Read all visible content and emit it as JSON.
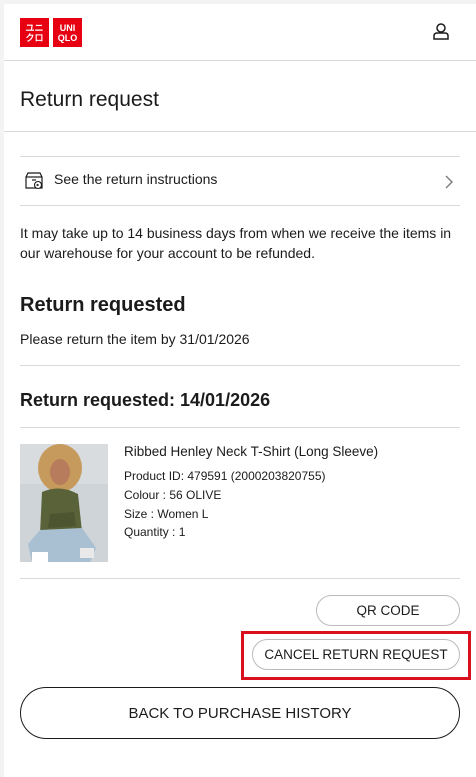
{
  "header": {
    "logo_top_left": "ユニ",
    "logo_top_right": "UNI",
    "logo_bottom_left": "クロ",
    "logo_bottom_right": "QLO",
    "account_icon": "account-icon"
  },
  "page_title": "Return request",
  "instructions": {
    "label": "See the return instructions",
    "icon": "box-return-icon",
    "chevron": "chevron-right-icon"
  },
  "info_text": "It may take up to 14 business days from when we receive the items in our warehouse for your account to be refunded.",
  "status": {
    "title": "Return requested",
    "due_text": "Please return the item by 31/01/2026",
    "requested_date": "Return requested: 14/01/2026"
  },
  "product": {
    "name": "Ribbed Henley Neck T-Shirt (Long Sleeve)",
    "id": "Product ID: 479591 (2000203820755)",
    "colour": "Colour : 56 OLIVE",
    "size": "Size : Women L",
    "quantity": "Quantity : 1"
  },
  "buttons": {
    "qr_code": "QR CODE",
    "cancel": "CANCEL RETURN REQUEST",
    "back": "BACK TO PURCHASE HISTORY"
  },
  "colors": {
    "brand_red": "#e60012",
    "highlight": "#d90f1e",
    "divider": "#dadada",
    "text": "#1b1b1b"
  }
}
